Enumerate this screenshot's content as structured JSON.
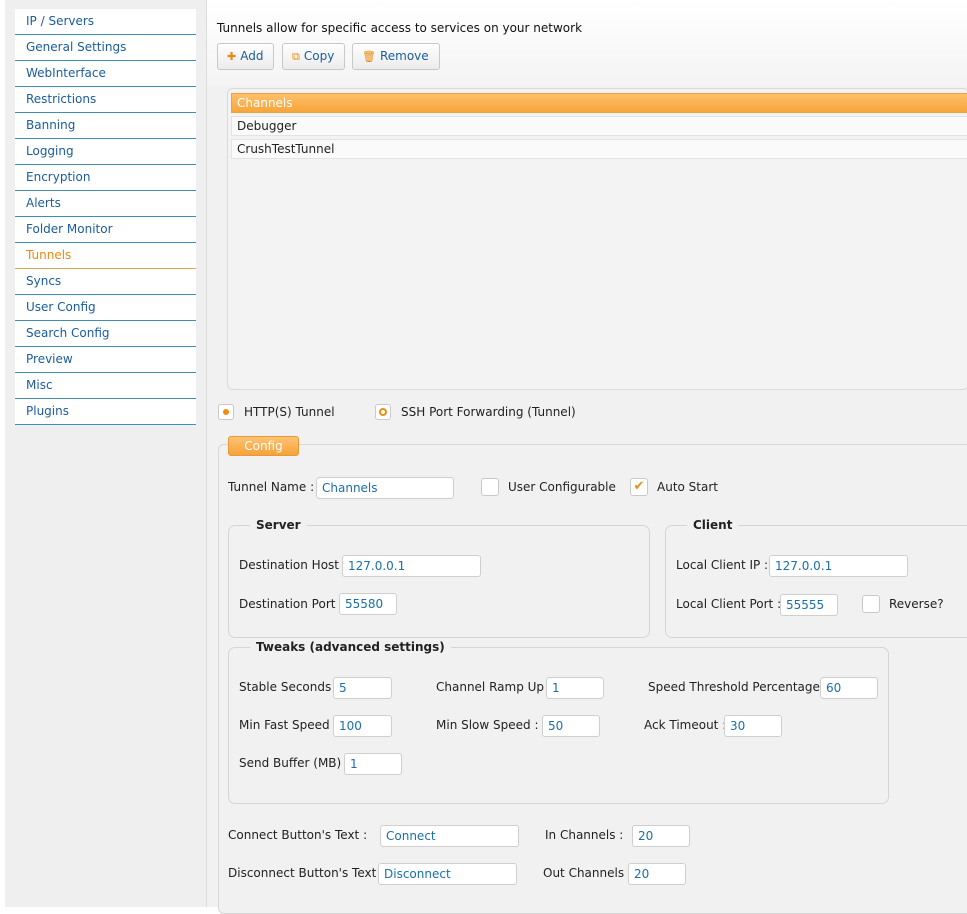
{
  "sidebar": {
    "items": [
      {
        "label": "IP / Servers"
      },
      {
        "label": "General Settings"
      },
      {
        "label": "WebInterface"
      },
      {
        "label": "Restrictions"
      },
      {
        "label": "Banning"
      },
      {
        "label": "Logging"
      },
      {
        "label": "Encryption"
      },
      {
        "label": "Alerts"
      },
      {
        "label": "Folder Monitor"
      },
      {
        "label": "Tunnels"
      },
      {
        "label": "Syncs"
      },
      {
        "label": "User Config"
      },
      {
        "label": "Search Config"
      },
      {
        "label": "Preview"
      },
      {
        "label": "Misc"
      },
      {
        "label": "Plugins"
      }
    ],
    "active": "Tunnels"
  },
  "header": {
    "intro": "Tunnels allow for specific access to services on your network",
    "add_label": "Add",
    "copy_label": "Copy",
    "remove_label": "Remove"
  },
  "tunnels": {
    "items": [
      "Channels",
      "Debugger",
      "CrushTestTunnel"
    ],
    "selected": "Channels"
  },
  "tunnel_type": {
    "http_label": "HTTP(S) Tunnel",
    "ssh_label": "SSH Port Forwarding (Tunnel)"
  },
  "config": {
    "tab_label": "Config",
    "tunnel_name_label": "Tunnel Name :",
    "tunnel_name": "Channels",
    "user_configurable_label": "User Configurable",
    "auto_start_label": "Auto Start",
    "server": {
      "legend": "Server",
      "dest_host_label": "Destination Host :",
      "dest_host": "127.0.0.1",
      "dest_port_label": "Destination Port :",
      "dest_port": "55580"
    },
    "client": {
      "legend": "Client",
      "local_ip_label": "Local Client IP :",
      "local_ip": "127.0.0.1",
      "local_port_label": "Local Client Port :",
      "local_port": "55555",
      "reverse_label": "Reverse?"
    },
    "tweaks": {
      "legend": "Tweaks (advanced settings)",
      "stable_seconds_label": "Stable Seconds :",
      "stable_seconds": "5",
      "ramp_up_label": "Channel Ramp Up :",
      "ramp_up": "1",
      "speed_threshold_label": "Speed Threshold Percentage :",
      "speed_threshold": "60",
      "min_fast_label": "Min Fast Speed :",
      "min_fast": "100",
      "min_slow_label": "Min Slow Speed :",
      "min_slow": "50",
      "ack_timeout_label": "Ack Timeout :",
      "ack_timeout": "30",
      "send_buffer_label": "Send Buffer (MB) :",
      "send_buffer": "1"
    },
    "connect_text_label": "Connect Button's Text :",
    "connect_text": "Connect",
    "in_channels_label": "In Channels :",
    "in_channels": "20",
    "disconnect_text_label": "Disconnect Button's Text :",
    "disconnect_text": "Disconnect",
    "out_channels_label": "Out Channels :",
    "out_channels": "20"
  }
}
